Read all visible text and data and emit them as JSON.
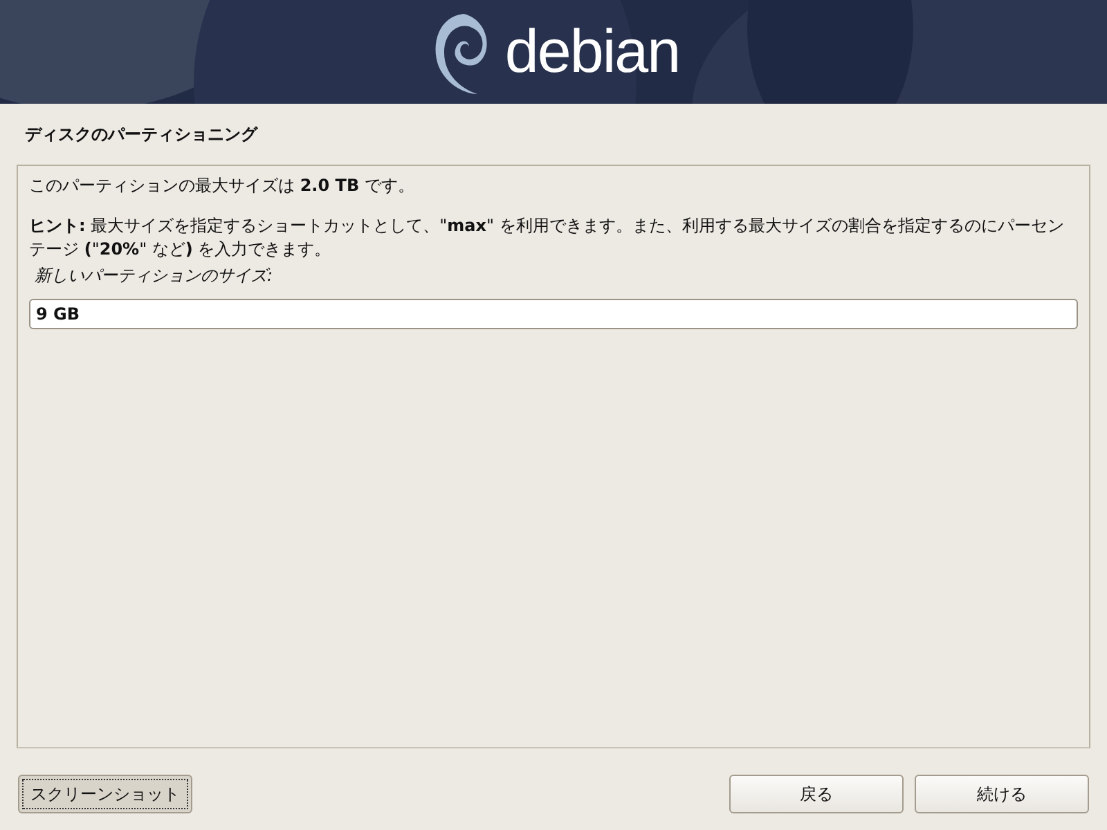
{
  "header": {
    "logo_text": "debian"
  },
  "page_title": "ディスクのパーティショニング",
  "panel": {
    "info": "このパーティションの最大サイズは **2.0 TB** です。",
    "hint": "**ヒント:** 最大サイズを指定するショートカットとして、\"**max**\" を利用できます。また、利用する最大サイズの割合を指定するのにパーセンテージ **(**\"**20%**\" など**)** を入力できます。",
    "field_label": "新しいパーティションのサイズ:",
    "field_value": "9 GB"
  },
  "buttons": [
    {
      "label": "スクリーンショット",
      "focused": true
    },
    {
      "label": "戻る",
      "focused": false
    },
    {
      "label": "続ける",
      "focused": false
    }
  ]
}
